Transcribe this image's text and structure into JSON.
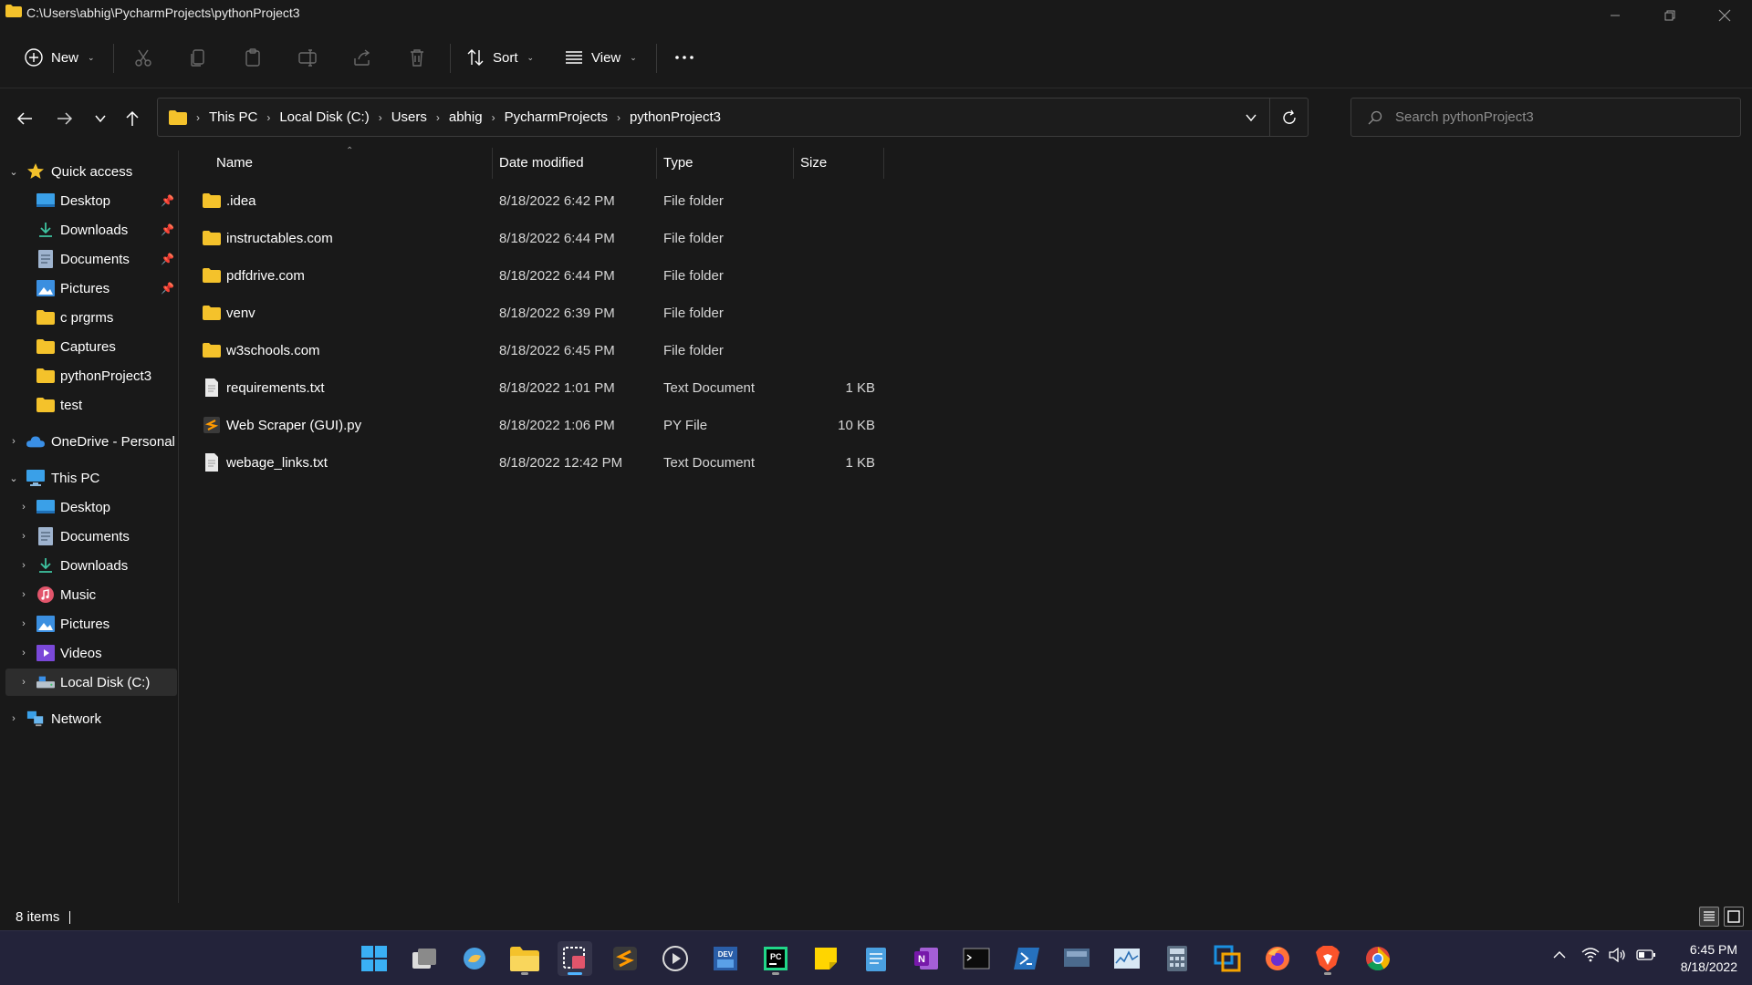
{
  "window": {
    "title": "C:\\Users\\abhig\\PycharmProjects\\pythonProject3"
  },
  "commandbar": {
    "new_label": "New",
    "sort_label": "Sort",
    "view_label": "View"
  },
  "address": {
    "breadcrumbs": [
      "This PC",
      "Local Disk (C:)",
      "Users",
      "abhig",
      "PycharmProjects",
      "pythonProject3"
    ]
  },
  "search": {
    "placeholder": "Search pythonProject3"
  },
  "sidebar": {
    "quick_access": "Quick access",
    "quick_items": [
      "Desktop",
      "Downloads",
      "Documents",
      "Pictures",
      "c prgrms",
      "Captures",
      "pythonProject3",
      "test"
    ],
    "onedrive": "OneDrive - Personal",
    "this_pc": "This PC",
    "pc_items": [
      "Desktop",
      "Documents",
      "Downloads",
      "Music",
      "Pictures",
      "Videos",
      "Local Disk (C:)"
    ],
    "network": "Network"
  },
  "columns": {
    "name": "Name",
    "date": "Date modified",
    "type": "Type",
    "size": "Size"
  },
  "files": [
    {
      "name": ".idea",
      "date": "8/18/2022 6:42 PM",
      "type": "File folder",
      "size": "",
      "icon": "folder-icon"
    },
    {
      "name": "instructables.com",
      "date": "8/18/2022 6:44 PM",
      "type": "File folder",
      "size": "",
      "icon": "folder-icon"
    },
    {
      "name": "pdfdrive.com",
      "date": "8/18/2022 6:44 PM",
      "type": "File folder",
      "size": "",
      "icon": "folder-icon"
    },
    {
      "name": "venv",
      "date": "8/18/2022 6:39 PM",
      "type": "File folder",
      "size": "",
      "icon": "folder-icon"
    },
    {
      "name": "w3schools.com",
      "date": "8/18/2022 6:45 PM",
      "type": "File folder",
      "size": "",
      "icon": "folder-icon"
    },
    {
      "name": "requirements.txt",
      "date": "8/18/2022 1:01 PM",
      "type": "Text Document",
      "size": "1 KB",
      "icon": "text-file-icon"
    },
    {
      "name": "Web Scraper (GUI).py",
      "date": "8/18/2022 1:06 PM",
      "type": "PY File",
      "size": "10 KB",
      "icon": "python-file-icon"
    },
    {
      "name": "webage_links.txt",
      "date": "8/18/2022 12:42 PM",
      "type": "Text Document",
      "size": "1 KB",
      "icon": "text-file-icon"
    }
  ],
  "status": {
    "item_count": "8 items"
  },
  "clock": {
    "time": "6:45 PM",
    "date": "8/18/2022"
  },
  "colors": {
    "folder": "#f4c22b",
    "accent": "#4fb3ff",
    "taskbar": "#23233a"
  }
}
